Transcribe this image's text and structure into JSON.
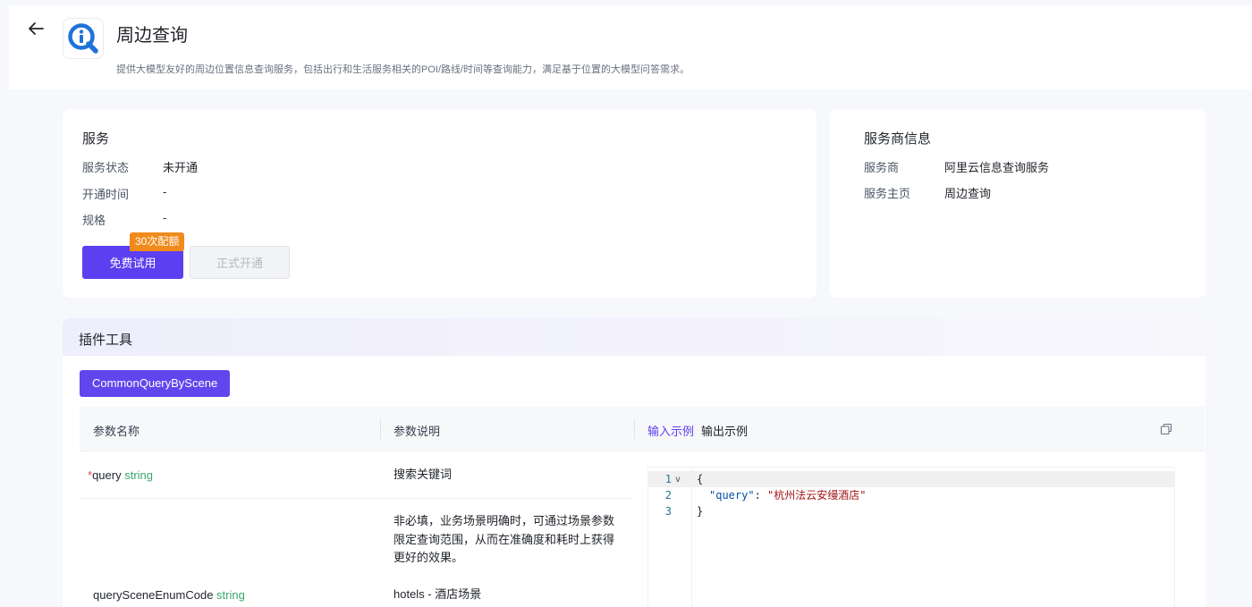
{
  "header": {
    "title": "周边查询",
    "description": "提供大模型友好的周边位置信息查询服务，包括出行和生活服务相关的POI/路线/时间等查询能力，满足基于位置的大模型问答需求。",
    "back_icon": "arrow-left-icon",
    "logo_icon": "search-info-icon"
  },
  "service": {
    "title": "服务",
    "status_label": "服务状态",
    "status_value": "未开通",
    "open_time_label": "开通时间",
    "open_time_value": "-",
    "spec_label": "规格",
    "spec_value": "-",
    "trial_button": "免费试用",
    "trial_badge": "30次配额",
    "formal_button": "正式开通"
  },
  "provider": {
    "title": "服务商信息",
    "provider_label": "服务商",
    "provider_value": "阿里云信息查询服务",
    "homepage_label": "服务主页",
    "homepage_value": "周边查询"
  },
  "plugin": {
    "title": "插件工具",
    "tool_tab": "CommonQueryByScene",
    "columns": {
      "name": "参数名称",
      "desc": "参数说明",
      "input_example": "输入示例",
      "output_example": "输出示例"
    },
    "params": [
      {
        "required_mark": "*",
        "name": "query",
        "type": "string",
        "desc": [
          "搜索关键词"
        ]
      },
      {
        "required_mark": "",
        "name": "querySceneEnumCode",
        "type": "string",
        "desc": [
          "非必填，业务场景明确时，可通过场景参数",
          "限定查询范围，从而在准确度和耗时上获得",
          "更好的效果。",
          "hotels - 酒店场景"
        ]
      }
    ],
    "code": {
      "lines": [
        "1",
        "2",
        "3"
      ],
      "line1": "{",
      "key": "\"query\"",
      "colon": ": ",
      "value": "\"杭州法云安缦酒店\"",
      "line3": "}"
    }
  },
  "colors": {
    "accent": "#5b3ff0",
    "badge": "#f08a1c",
    "type_green": "#3aa669",
    "link": "#5b3ff0"
  }
}
